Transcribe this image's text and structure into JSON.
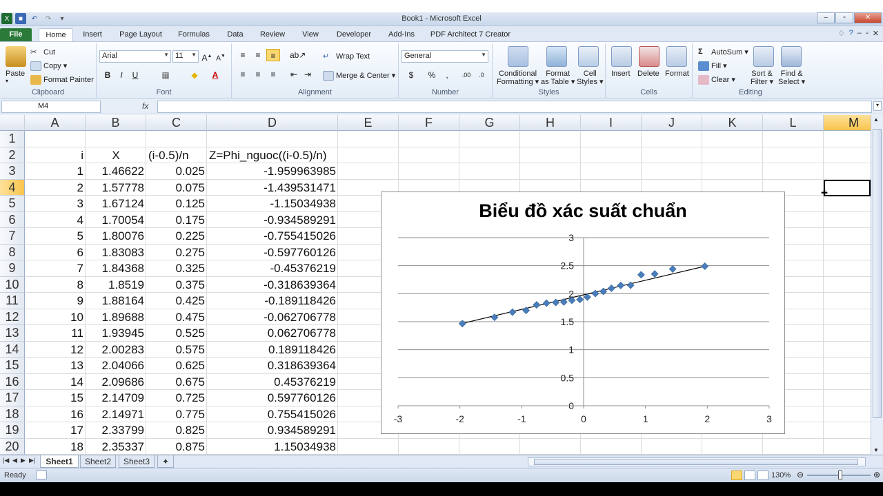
{
  "window": {
    "title": "Book1 - Microsoft Excel"
  },
  "tabs": [
    "File",
    "Home",
    "Insert",
    "Page Layout",
    "Formulas",
    "Data",
    "Review",
    "View",
    "Developer",
    "Add-Ins",
    "PDF Architect 7 Creator"
  ],
  "ribbon": {
    "clipboard": {
      "paste": "Paste",
      "cut": "Cut",
      "copy": "Copy ▾",
      "format_painter": "Format Painter",
      "label": "Clipboard"
    },
    "font": {
      "name": "Arial",
      "size": "11",
      "label": "Font"
    },
    "alignment": {
      "wrap": "Wrap Text",
      "merge": "Merge & Center ▾",
      "label": "Alignment"
    },
    "number": {
      "format": "General",
      "label": "Number"
    },
    "styles": {
      "conditional": "Conditional\nFormatting ▾",
      "format_table": "Format\nas Table ▾",
      "cell_styles": "Cell\nStyles ▾",
      "label": "Styles"
    },
    "cells": {
      "insert": "Insert",
      "delete": "Delete",
      "format": "Format",
      "label": "Cells"
    },
    "editing": {
      "autosum": "AutoSum ▾",
      "fill": "Fill ▾",
      "clear": "Clear ▾",
      "sort": "Sort &\nFilter ▾",
      "find": "Find &\nSelect ▾",
      "label": "Editing"
    }
  },
  "formula_bar": {
    "name_box": "M4",
    "fx": "fx",
    "formula": ""
  },
  "columns": [
    "A",
    "B",
    "C",
    "D",
    "E",
    "F",
    "G",
    "H",
    "I",
    "J",
    "K",
    "L",
    "M"
  ],
  "rows": [
    "1",
    "2",
    "3",
    "4",
    "5",
    "6",
    "7",
    "8",
    "9",
    "10",
    "11",
    "12",
    "13",
    "14",
    "15",
    "16",
    "17",
    "18",
    "19",
    "20"
  ],
  "selected": {
    "col": "M",
    "row": "4"
  },
  "headers": {
    "a": "i",
    "b": "X",
    "c": "(i-0.5)/n",
    "d": "Z=Phi_nguoc((i-0.5)/n)"
  },
  "table": [
    [
      "1",
      "1.46622",
      "0.025",
      "-1.959963985"
    ],
    [
      "2",
      "1.57778",
      "0.075",
      "-1.439531471"
    ],
    [
      "3",
      "1.67124",
      "0.125",
      "-1.15034938"
    ],
    [
      "4",
      "1.70054",
      "0.175",
      "-0.934589291"
    ],
    [
      "5",
      "1.80076",
      "0.225",
      "-0.755415026"
    ],
    [
      "6",
      "1.83083",
      "0.275",
      "-0.597760126"
    ],
    [
      "7",
      "1.84368",
      "0.325",
      "-0.45376219"
    ],
    [
      "8",
      "1.8519",
      "0.375",
      "-0.318639364"
    ],
    [
      "9",
      "1.88164",
      "0.425",
      "-0.189118426"
    ],
    [
      "10",
      "1.89688",
      "0.475",
      "-0.062706778"
    ],
    [
      "11",
      "1.93945",
      "0.525",
      "0.062706778"
    ],
    [
      "12",
      "2.00283",
      "0.575",
      "0.189118426"
    ],
    [
      "13",
      "2.04066",
      "0.625",
      "0.318639364"
    ],
    [
      "14",
      "2.09686",
      "0.675",
      "0.45376219"
    ],
    [
      "15",
      "2.14709",
      "0.725",
      "0.597760126"
    ],
    [
      "16",
      "2.14971",
      "0.775",
      "0.755415026"
    ],
    [
      "17",
      "2.33799",
      "0.825",
      "0.934589291"
    ],
    [
      "18",
      "2.35337",
      "0.875",
      "1.15034938"
    ]
  ],
  "chart_data": {
    "type": "scatter",
    "title": "Biểu đồ xác suất chuẩn",
    "xlim": [
      -3,
      3
    ],
    "ylim": [
      0,
      3
    ],
    "xticks": [
      "-3",
      "-2",
      "-1",
      "0",
      "1",
      "2",
      "3"
    ],
    "yticks": [
      "0",
      "0.5",
      "1",
      "1.5",
      "2",
      "2.5",
      "3"
    ],
    "grid": "horizontal",
    "trendline": {
      "x": [
        -1.96,
        1.96
      ],
      "y": [
        1.47,
        2.49
      ]
    },
    "marker_color": "#4a7ebb",
    "points": [
      [
        -1.96,
        1.466
      ],
      [
        -1.44,
        1.578
      ],
      [
        -1.15,
        1.671
      ],
      [
        -0.93,
        1.701
      ],
      [
        -0.76,
        1.801
      ],
      [
        -0.6,
        1.831
      ],
      [
        -0.45,
        1.844
      ],
      [
        -0.32,
        1.852
      ],
      [
        -0.19,
        1.882
      ],
      [
        -0.06,
        1.897
      ],
      [
        0.06,
        1.939
      ],
      [
        0.19,
        2.003
      ],
      [
        0.32,
        2.041
      ],
      [
        0.45,
        2.097
      ],
      [
        0.6,
        2.147
      ],
      [
        0.76,
        2.15
      ],
      [
        0.93,
        2.338
      ],
      [
        1.15,
        2.353
      ],
      [
        1.44,
        2.44
      ],
      [
        1.96,
        2.49
      ]
    ]
  },
  "sheets": [
    "Sheet1",
    "Sheet2",
    "Sheet3"
  ],
  "active_sheet": "Sheet1",
  "status": {
    "text": "Ready",
    "zoom": "130%"
  }
}
